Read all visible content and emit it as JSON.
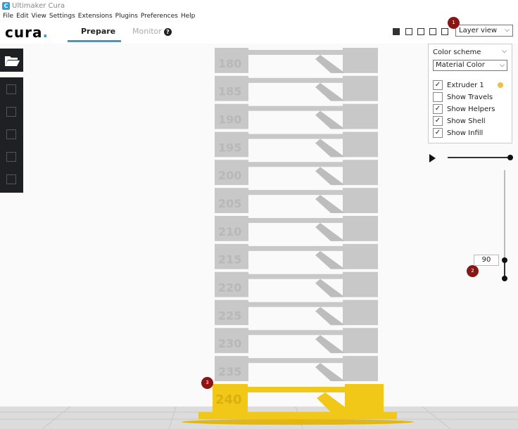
{
  "window": {
    "title": "Ultimaker Cura"
  },
  "menu": [
    "File",
    "Edit",
    "View",
    "Settings",
    "Extensions",
    "Plugins",
    "Preferences",
    "Help"
  ],
  "header": {
    "logo": "cura",
    "tabs": [
      {
        "label": "Prepare",
        "active": true
      },
      {
        "label": "Monitor",
        "active": false
      }
    ],
    "view_select": "Layer view"
  },
  "badges": [
    "1",
    "2",
    "3"
  ],
  "panel": {
    "color_scheme_label": "Color scheme",
    "scheme_value": "Material Color",
    "items": [
      {
        "label": "Extruder 1",
        "checked": true,
        "swatch": "#e8c243"
      },
      {
        "label": "Show Travels",
        "checked": false
      },
      {
        "label": "Show Helpers",
        "checked": true
      },
      {
        "label": "Show Shell",
        "checked": true
      },
      {
        "label": "Show Infill",
        "checked": true
      }
    ]
  },
  "layer_slider": {
    "current_layer": "90"
  },
  "model": {
    "temperature_labels": [
      "180",
      "185",
      "190",
      "195",
      "200",
      "205",
      "210",
      "215",
      "220",
      "225",
      "230",
      "235",
      "240"
    ],
    "colors": {
      "gray": "#c8c8c8",
      "yellow": "#f2c818",
      "accent": "#2e9fdb",
      "badge": "#8b1414"
    }
  }
}
